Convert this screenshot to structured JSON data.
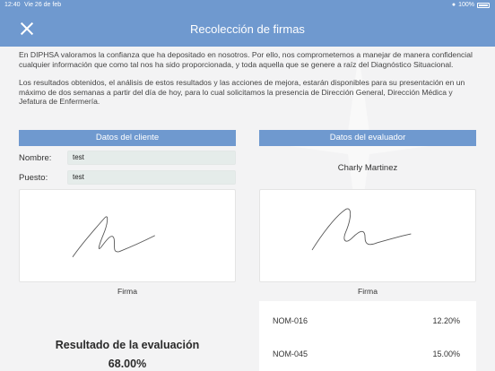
{
  "status_bar": {
    "time": "12:40",
    "date": "Vie 26 de feb",
    "battery": "100%"
  },
  "nav": {
    "title": "Recolección de firmas"
  },
  "intro": {
    "paragraph1": "En DIPHSA valoramos la confianza que ha depositado en nosotros. Por ello, nos comprometemos a manejar de manera confidencial cualquier información que como tal nos ha sido proporcionada, y toda aquella que se genere a raíz del Diagnóstico Situacional.",
    "paragraph2": "Los resultados obtenidos, el análisis de estos resultados y las acciones de mejora, estarán disponibles para su presentación en un máximo de dos semanas a partir del día de hoy, para lo cual solicitamos la presencia de Dirección General, Dirección Médica y Jefatura de Enfermería."
  },
  "client": {
    "header": "Datos del cliente",
    "name_label": "Nombre:",
    "name_value": "test",
    "position_label": "Puesto:",
    "position_value": "test",
    "signature_caption": "Firma"
  },
  "evaluator": {
    "header": "Datos del evaluador",
    "name": "Charly Martinez",
    "signature_caption": "Firma"
  },
  "result": {
    "title": "Resultado de la evaluación",
    "value": "68.00%"
  },
  "scores": [
    {
      "name": "NOM-016",
      "value": "12.20%"
    },
    {
      "name": "NOM-045",
      "value": "15.00%"
    }
  ],
  "colors": {
    "accent": "#6f99cf",
    "background": "#f3f3f4",
    "input_bg": "#e5ecea"
  }
}
